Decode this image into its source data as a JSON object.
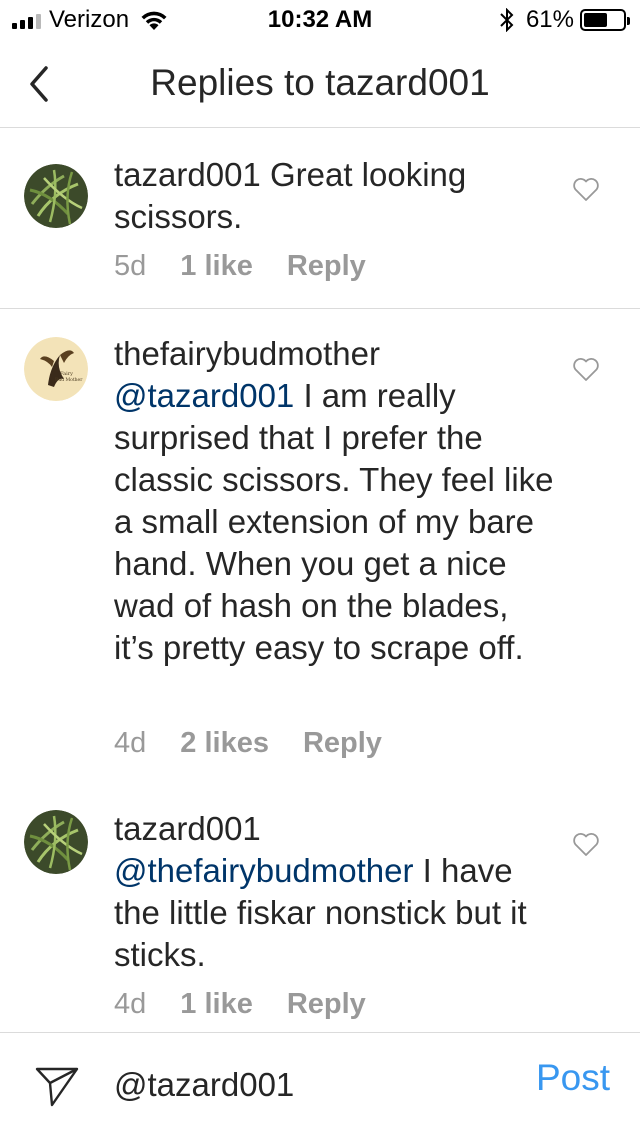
{
  "status_bar": {
    "carrier": "Verizon",
    "time": "10:32 AM",
    "battery": "61%",
    "battery_level": 0.61
  },
  "nav": {
    "title": "Replies to tazard001"
  },
  "comments": [
    {
      "username": "tazard001",
      "mention": "",
      "text": " Great looking scissors.",
      "age": "5d",
      "likes": "1 like",
      "reply": "Reply",
      "avatar": "leaf-avatar"
    },
    {
      "username": "thefairybudmother",
      "mention": "@tazard001",
      "text": " I am really surprised that I prefer the classic scissors. They feel like a small extension of my bare hand. When you get a nice wad of hash on the blades, it’s pretty easy to scrape off.",
      "age": "4d",
      "likes": "2 likes",
      "reply": "Reply",
      "avatar": "fairy-avatar",
      "avatar_text": [
        "Fairy",
        "Bud Mother"
      ]
    },
    {
      "username": "tazard001",
      "mention": "@thefairybudmother",
      "text": " I have the little fiskar nonstick but it sticks.",
      "age": "4d",
      "likes": "1 like",
      "reply": "Reply",
      "avatar": "leaf-avatar"
    }
  ],
  "input": {
    "value": "@tazard001",
    "post_label": "Post"
  },
  "colors": {
    "mention": "#003569",
    "post": "#3897f0",
    "meta": "#999999"
  }
}
